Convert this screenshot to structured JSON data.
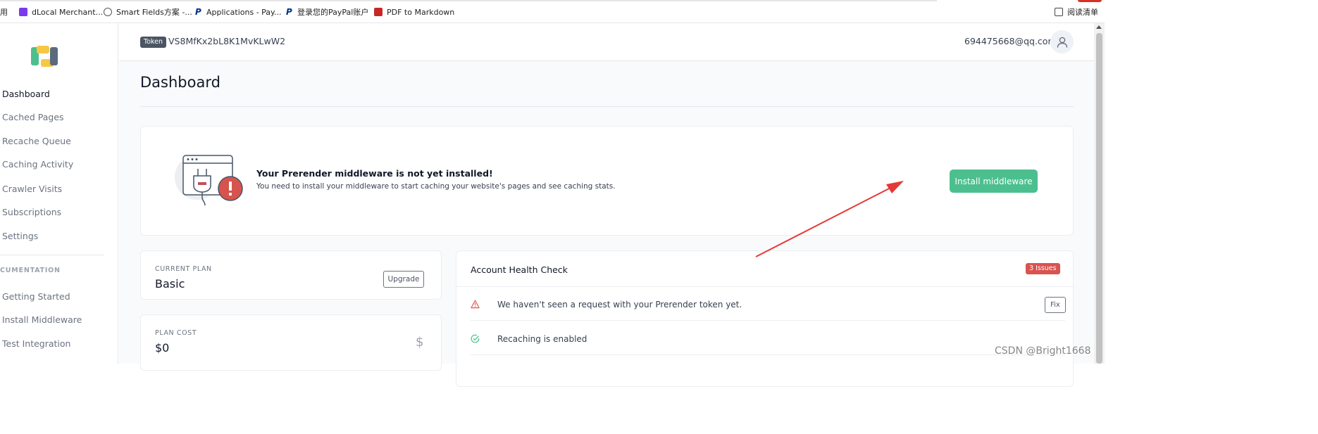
{
  "bookmarks": {
    "items": [
      {
        "label": "用"
      },
      {
        "label": "dLocal Merchant...",
        "icon": "dlocal-favicon"
      },
      {
        "label": "Smart Fields方案 -...",
        "icon": "globe-icon"
      },
      {
        "label": "Applications - Pay...",
        "icon": "paypal-icon"
      },
      {
        "label": "登录您的PayPal账户",
        "icon": "paypal-icon"
      },
      {
        "label": "PDF to Markdown",
        "icon": "pdf-icon"
      }
    ],
    "reading_list": "阅读清单"
  },
  "sidebar": {
    "logo_icon": "prerender-logo",
    "nav": [
      {
        "label": "Dashboard",
        "active": true
      },
      {
        "label": "Cached Pages"
      },
      {
        "label": "Recache Queue"
      },
      {
        "label": "Caching Activity"
      },
      {
        "label": "Crawler Visits"
      },
      {
        "label": "Subscriptions"
      },
      {
        "label": "Settings"
      }
    ],
    "section_label": "CUMENTATION",
    "docs": [
      {
        "label": "Getting Started"
      },
      {
        "label": "Install Middleware"
      },
      {
        "label": "Test Integration"
      }
    ]
  },
  "header": {
    "token_label": "Token",
    "token_value": "VS8MfKx2bL8K1MvKLwW2",
    "user_email": "694475668@qq.com",
    "avatar_icon": "user-icon"
  },
  "main": {
    "page_title": "Dashboard",
    "banner": {
      "title": "Your Prerender middleware is not yet installed!",
      "text": "You need to install your middleware to start caching your website's pages and see caching stats.",
      "button": "Install middleware",
      "illustration": "plug-warning-illustration"
    },
    "current_plan": {
      "label": "CURRENT PLAN",
      "value": "Basic",
      "button": "Upgrade"
    },
    "plan_cost": {
      "label": "PLAN COST",
      "value": "$0",
      "icon": "dollar-icon"
    },
    "health": {
      "title": "Account Health Check",
      "badge": "3 Issues",
      "rows": [
        {
          "text": "We haven't seen a request with your Prerender token yet.",
          "status": "warning",
          "action": "Fix"
        },
        {
          "text": "Recaching is enabled",
          "status": "ok"
        }
      ]
    }
  },
  "colors": {
    "accent_green": "#4cbf8e",
    "issue_red": "#d9534f",
    "warning_red": "#e05a4f",
    "annotation_arrow": "#e53935"
  },
  "watermark": "CSDN @Bright1668"
}
